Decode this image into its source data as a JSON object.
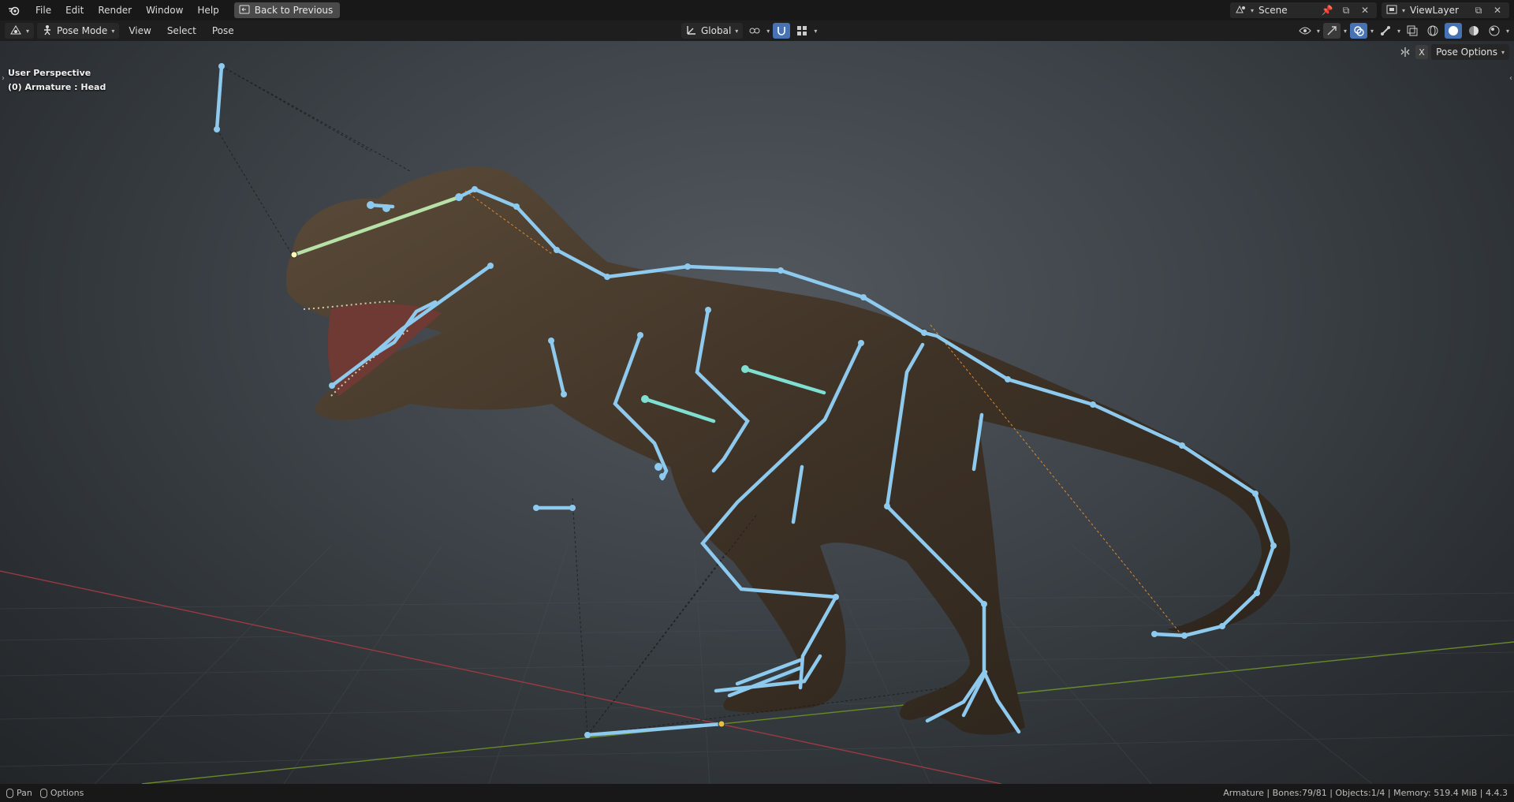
{
  "menubar": {
    "items": [
      "File",
      "Edit",
      "Render",
      "Window",
      "Help"
    ],
    "back_button": "Back to Previous",
    "scene_name": "Scene",
    "view_layer": "ViewLayer"
  },
  "header": {
    "mode": "Pose Mode",
    "menus": [
      "View",
      "Select",
      "Pose"
    ],
    "transform_orientation": "Global"
  },
  "viewport": {
    "view_name": "User Perspective",
    "active_object": "(0) Armature : Head",
    "pose_options": "Pose Options",
    "x_toggle": "X"
  },
  "statusbar": {
    "pan_label": "Pan",
    "options_label": "Options",
    "stats": "Armature | Bones:79/81 | Objects:1/4 | Memory: 519.4 MiB | 4.4.3"
  },
  "colors": {
    "bone": "#8ec9ee",
    "bone_selected": "#7fe0d2",
    "accent": "#4772b3",
    "grid_x_axis": "#9a3a42",
    "grid_y_axis": "#6a8a2a"
  }
}
